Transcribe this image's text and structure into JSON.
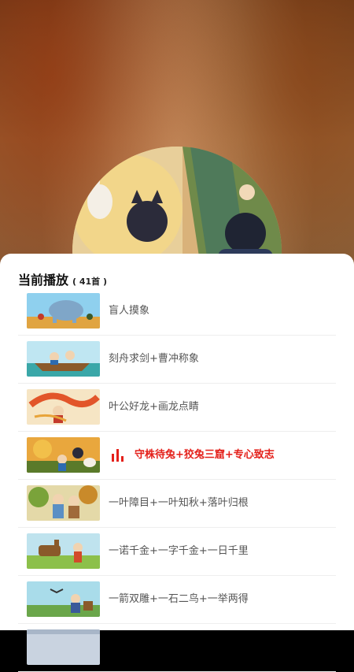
{
  "playlist": {
    "title": "当前播放",
    "count": "( 41首 )",
    "items": [
      {
        "title": "盲人摸象",
        "active": false
      },
      {
        "title": "刻舟求剑+曹冲称象",
        "active": false
      },
      {
        "title": "叶公好龙+画龙点睛",
        "active": false
      },
      {
        "title": "守株待兔+狡兔三窟+专心致志",
        "active": true,
        "icon": "equalizer-icon"
      },
      {
        "title": "一叶障目+一叶知秋+落叶归根",
        "active": false
      },
      {
        "title": "一诺千金+一字千金+一日千里",
        "active": false
      },
      {
        "title": "一箭双雕+一石二鸟+一举两得",
        "active": false
      },
      {
        "title": "",
        "active": false
      }
    ]
  },
  "colors": {
    "active": "#e4201a",
    "text": "#555555",
    "title": "#111111"
  }
}
